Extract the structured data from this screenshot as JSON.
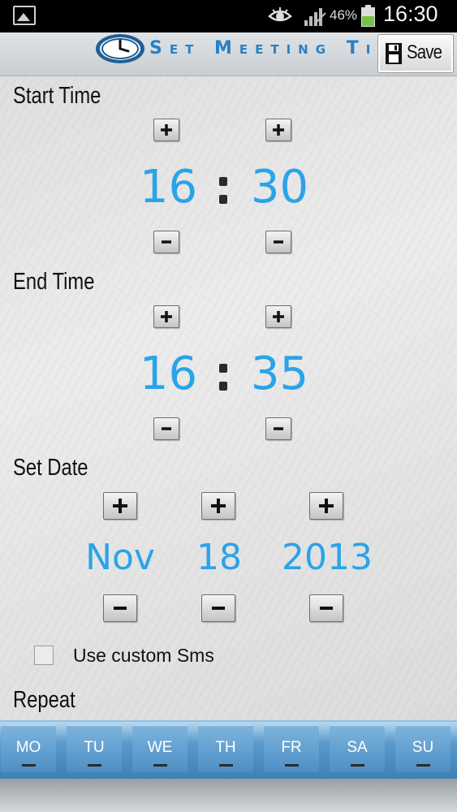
{
  "status_bar": {
    "battery_percent": "46%",
    "time": "16:30",
    "icons": [
      "gallery-icon",
      "eye-icon",
      "signal-icon",
      "battery-icon"
    ]
  },
  "header": {
    "title": "Set Meeting Time",
    "save_label": "Save",
    "icons": [
      "clock-icon",
      "floppy-icon"
    ]
  },
  "start_time": {
    "label": "Start Time",
    "hour": "16",
    "minute": "30"
  },
  "end_time": {
    "label": "End Time",
    "hour": "16",
    "minute": "35"
  },
  "set_date": {
    "label": "Set Date",
    "month": "Nov",
    "day": "18",
    "year": "2013"
  },
  "custom_sms": {
    "label": "Use custom Sms",
    "checked": false
  },
  "repeat": {
    "label": "Repeat",
    "days": [
      "MO",
      "TU",
      "WE",
      "TH",
      "FR",
      "SA",
      "SU"
    ]
  },
  "colors": {
    "value_blue": "#2ba3e8",
    "title_blue": "#2a80c4",
    "day_bar_blue": "#4c8fc6"
  }
}
